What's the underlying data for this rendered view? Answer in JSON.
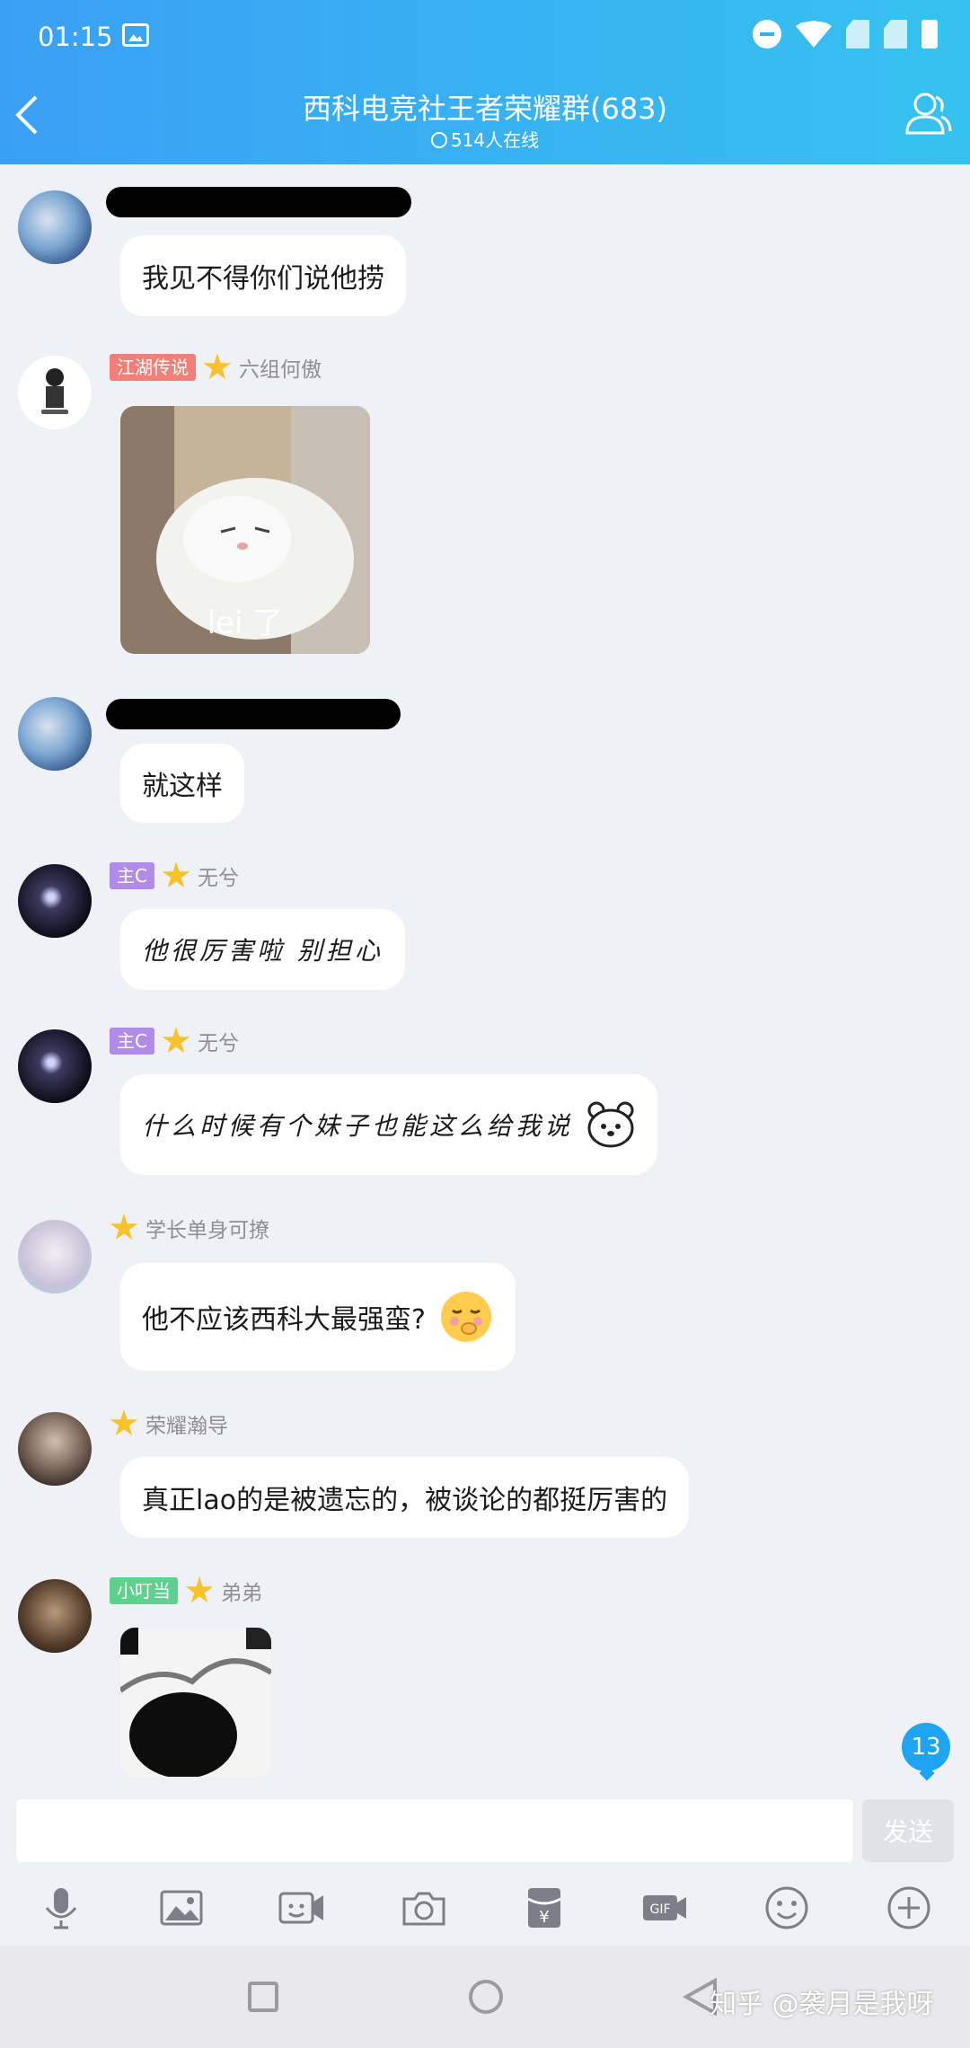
{
  "status_bar": {
    "time": "01:15"
  },
  "header": {
    "title": "西科电竞社王者荣耀群(683)",
    "online": "514人在线"
  },
  "messages": [
    {
      "nickname": "",
      "text": "我见不得你们说他捞"
    },
    {
      "badge": "江湖传说",
      "badge_color": "#f37f78",
      "nickname": "六组何傲",
      "image_caption": "lei 了"
    },
    {
      "nickname": "",
      "text": "就这样"
    },
    {
      "badge": "主C",
      "badge_color": "#b08be8",
      "nickname": "无兮",
      "text": "他很厉害啦 别担心"
    },
    {
      "badge": "主C",
      "badge_color": "#b08be8",
      "nickname": "无兮",
      "text": "什么时候有个妹子也能这么给我说"
    },
    {
      "nickname": "学长单身可撩",
      "text": "他不应该西科大最强蛮?"
    },
    {
      "nickname": "荣耀瀚导",
      "text": "真正lao的是被遗忘的，被谈论的都挺厉害的"
    },
    {
      "badge": "小叮当",
      "badge_color": "#5fd18f",
      "nickname": "弟弟"
    }
  ],
  "unread_count": "13",
  "composer": {
    "input_value": "",
    "send_label": "发送"
  },
  "toolbar_icons": [
    "mic-icon",
    "image-icon",
    "video-call-icon",
    "camera-icon",
    "red-packet-icon",
    "gif-icon",
    "emoji-icon",
    "plus-icon"
  ],
  "watermark": "知乎 @袭月是我呀",
  "colors": {
    "header_start": "#3aa0f5",
    "header_end": "#36c2ef",
    "star": "#f8c22a",
    "unread": "#1ea4f3"
  }
}
